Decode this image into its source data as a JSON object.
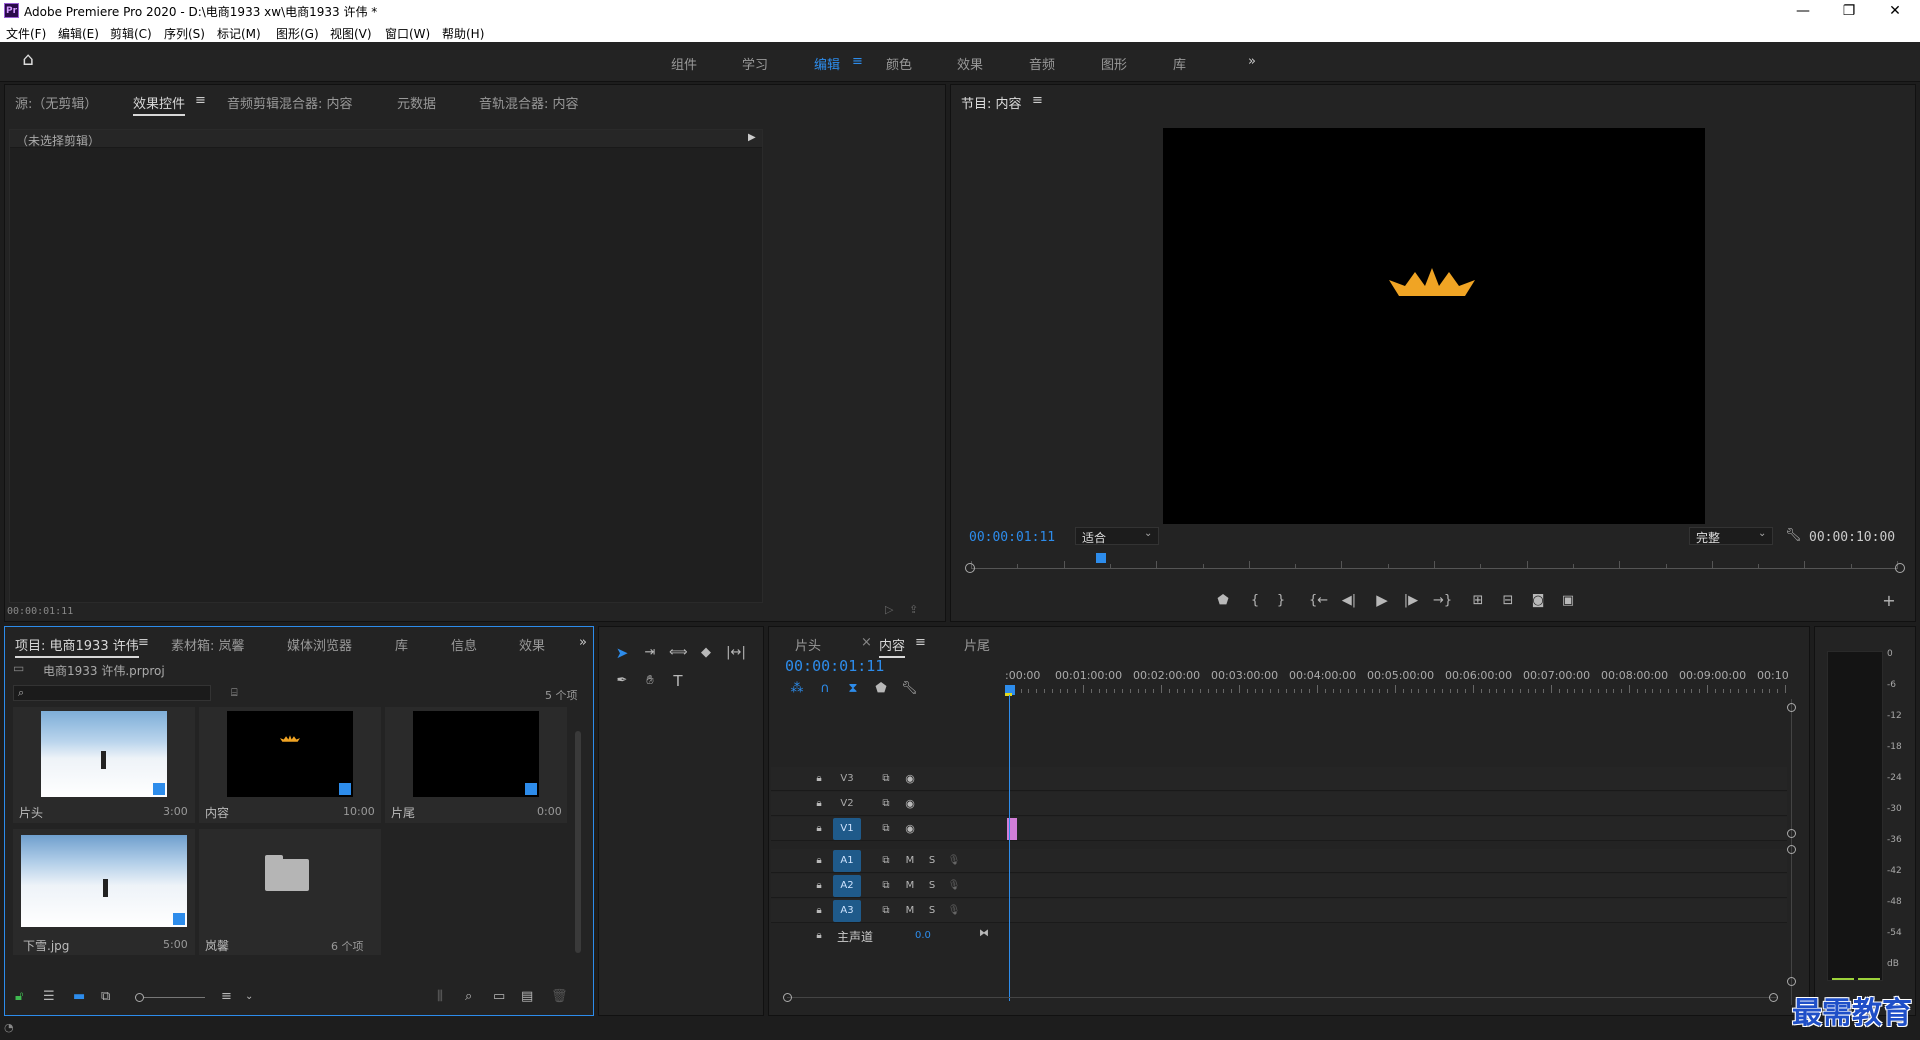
{
  "window": {
    "title": "Adobe Premiere Pro 2020 - D:\\电商1933 xw\\电商1933 许伟 *",
    "logo_text": "Pr",
    "controls": [
      "—",
      "❐",
      "✕"
    ]
  },
  "menu": [
    "文件(F)",
    "编辑(E)",
    "剪辑(C)",
    "序列(S)",
    "标记(M)",
    "图形(G)",
    "视图(V)",
    "窗口(W)",
    "帮助(H)"
  ],
  "workspaces": {
    "items": [
      "组件",
      "学习",
      "编辑",
      "颜色",
      "效果",
      "音频",
      "图形",
      "库"
    ],
    "active": "编辑",
    "more": "»"
  },
  "source_panel": {
    "tabs": [
      "源:（无剪辑）",
      "效果控件",
      "音频剪辑混合器: 内容",
      "元数据",
      "音轨混合器: 内容"
    ],
    "active_tab": "效果控件",
    "no_clip": "（未选择剪辑）",
    "timecode": "00:00:01:11"
  },
  "program_panel": {
    "title": "节目: 内容",
    "timecode": "00:00:01:11",
    "fit": "适合",
    "quality": "完整",
    "duration": "00:00:10:00",
    "playhead_fraction": 0.14,
    "crown_color": "#f0a424"
  },
  "project_panel": {
    "tabs": [
      "项目: 电商1933 许伟",
      "素材箱: 岚馨",
      "媒体浏览器",
      "库",
      "信息",
      "效果"
    ],
    "active_tab": "项目: 电商1933 许伟",
    "project_file": "电商1933 许伟.prproj",
    "search_placeholder": "",
    "item_count": "5 个项",
    "items": [
      {
        "name": "片头",
        "duration": "3:00",
        "kind": "snow"
      },
      {
        "name": "内容",
        "duration": "10:00",
        "kind": "crown"
      },
      {
        "name": "片尾",
        "duration": "0:00",
        "kind": "black"
      },
      {
        "name": "下雪.jpg",
        "duration": "5:00",
        "kind": "snow"
      },
      {
        "name": "岚馨",
        "duration": "6 个项",
        "kind": "folder"
      }
    ]
  },
  "timeline": {
    "tabs": [
      "片头",
      "内容",
      "片尾"
    ],
    "active_tab": "内容",
    "timecode": "00:00:01:11",
    "ruler": [
      ":00:00",
      "00:01:00:00",
      "00:02:00:00",
      "00:03:00:00",
      "00:04:00:00",
      "00:05:00:00",
      "00:06:00:00",
      "00:07:00:00",
      "00:08:00:00",
      "00:09:00:00",
      "00:10"
    ],
    "video_tracks": [
      "V3",
      "V2",
      "V1"
    ],
    "audio_tracks": [
      "A1",
      "A2",
      "A3"
    ],
    "master_label": "主声道",
    "master_value": "0.0",
    "mute": "M",
    "solo": "S",
    "clip_color": "#d27ed8"
  },
  "meter": {
    "scale": [
      "0",
      "-6",
      "-12",
      "-18",
      "-24",
      "-30",
      "-36",
      "-42",
      "-48",
      "-54",
      "dB"
    ]
  },
  "watermark": "最需教育"
}
